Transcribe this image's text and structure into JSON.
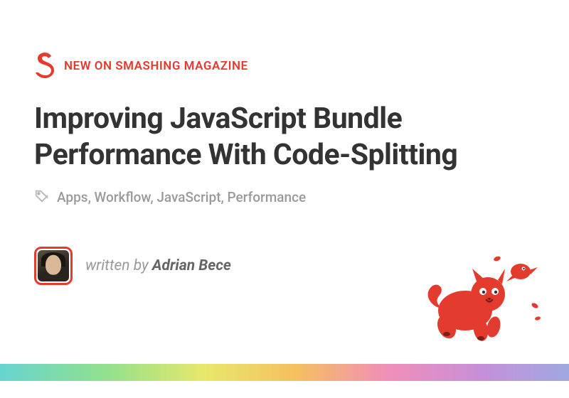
{
  "eyebrow": "NEW ON SMASHING MAGAZINE",
  "title": "Improving JavaScript Bundle Performance With Code-Splitting",
  "tags": "Apps, Workflow, JavaScript, Performance",
  "byline": {
    "prefix": "written by ",
    "author": "Adrian Bece"
  }
}
